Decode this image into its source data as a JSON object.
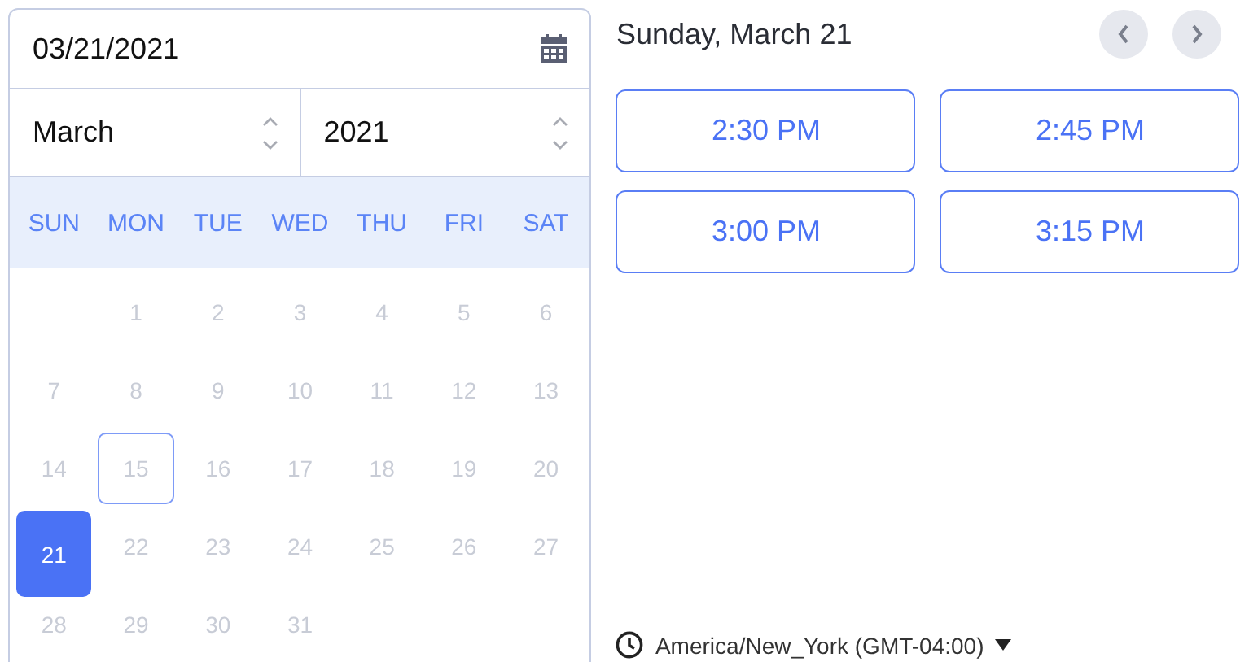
{
  "date_field": {
    "value": "03/21/2021"
  },
  "month_select": {
    "value": "March"
  },
  "year_select": {
    "value": "2021"
  },
  "weekdays": [
    "SUN",
    "MON",
    "TUE",
    "WED",
    "THU",
    "FRI",
    "SAT"
  ],
  "weeks": [
    {
      "days": [
        {
          "label": "1",
          "selected": false,
          "today": false
        },
        {
          "label": "2",
          "selected": false,
          "today": false
        },
        {
          "label": "3",
          "selected": false,
          "today": false
        },
        {
          "label": "4",
          "selected": false,
          "today": false
        },
        {
          "label": "5",
          "selected": false,
          "today": false
        },
        {
          "label": "6",
          "selected": false,
          "today": false
        }
      ]
    },
    {
      "days": [
        {
          "label": "7",
          "selected": false,
          "today": false
        },
        {
          "label": "8",
          "selected": false,
          "today": false
        },
        {
          "label": "9",
          "selected": false,
          "today": false
        },
        {
          "label": "10",
          "selected": false,
          "today": false
        },
        {
          "label": "11",
          "selected": false,
          "today": false
        },
        {
          "label": "12",
          "selected": false,
          "today": false
        },
        {
          "label": "13",
          "selected": false,
          "today": false
        }
      ]
    },
    {
      "days": [
        {
          "label": "14",
          "selected": false,
          "today": false
        },
        {
          "label": "15",
          "selected": false,
          "today": true
        },
        {
          "label": "16",
          "selected": false,
          "today": false
        },
        {
          "label": "17",
          "selected": false,
          "today": false
        },
        {
          "label": "18",
          "selected": false,
          "today": false
        },
        {
          "label": "19",
          "selected": false,
          "today": false
        },
        {
          "label": "20",
          "selected": false,
          "today": false
        }
      ]
    },
    {
      "days": [
        {
          "label": "21",
          "selected": true,
          "today": false
        },
        {
          "label": "22",
          "selected": false,
          "today": false
        },
        {
          "label": "23",
          "selected": false,
          "today": false
        },
        {
          "label": "24",
          "selected": false,
          "today": false
        },
        {
          "label": "25",
          "selected": false,
          "today": false
        },
        {
          "label": "26",
          "selected": false,
          "today": false
        },
        {
          "label": "27",
          "selected": false,
          "today": false
        }
      ]
    },
    {
      "days": [
        {
          "label": "28",
          "selected": false,
          "today": false
        },
        {
          "label": "29",
          "selected": false,
          "today": false
        },
        {
          "label": "30",
          "selected": false,
          "today": false
        },
        {
          "label": "31",
          "selected": false,
          "today": false
        }
      ]
    }
  ],
  "day_title": "Sunday, March 21",
  "time_slots": [
    "2:30 PM",
    "2:45 PM",
    "3:00 PM",
    "3:15 PM"
  ],
  "timezone": "America/New_York (GMT-04:00)"
}
